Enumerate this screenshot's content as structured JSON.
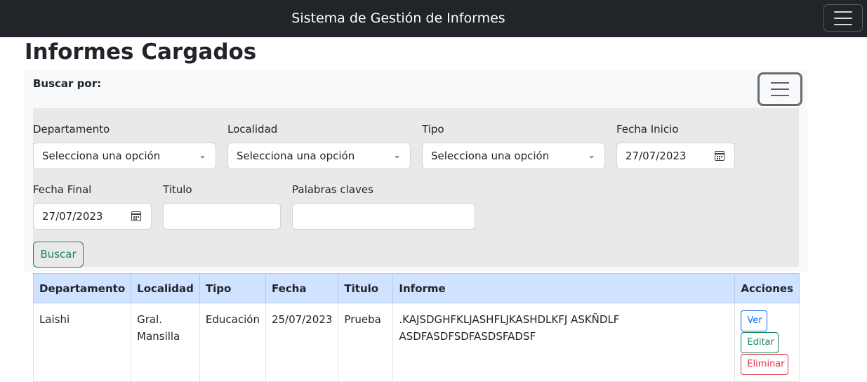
{
  "navbar": {
    "brand": "Sistema de Gestión de Informes"
  },
  "page": {
    "title": "Informes Cargados"
  },
  "search": {
    "label": "Buscar por:",
    "departamento": {
      "label": "Departamento",
      "value": "Selecciona una opción"
    },
    "localidad": {
      "label": "Localidad",
      "value": "Selecciona una opción"
    },
    "tipo": {
      "label": "Tipo",
      "value": "Selecciona una opción"
    },
    "fecha_inicio": {
      "label": "Fecha Inicio",
      "value": "27/07/2023"
    },
    "fecha_final": {
      "label": "Fecha Final",
      "value": "27/07/2023"
    },
    "titulo": {
      "label": "Titulo",
      "value": ""
    },
    "palabras": {
      "label": "Palabras claves",
      "value": ""
    },
    "button": "Buscar"
  },
  "table": {
    "headers": [
      "Departamento",
      "Localidad",
      "Tipo",
      "Fecha",
      "Titulo",
      "Informe",
      "Acciones"
    ],
    "rows": [
      {
        "departamento": "Laishi",
        "localidad": "Gral. Mansilla",
        "tipo": "Educación",
        "fecha": "25/07/2023",
        "titulo": "Prueba",
        "informe": ".KAJSDGHFKLJASHFLJKASHDLKFJ ASKÑDLF ASDFASDFSDFASDSFADSF",
        "actions": {
          "ver": "Ver",
          "editar": "Editar",
          "eliminar": "Eliminar"
        }
      }
    ]
  },
  "colors": {
    "navbar": "#212529",
    "table_header": "#cfe2ff",
    "primary": "#0d6efd",
    "success": "#198754",
    "danger": "#dc3545"
  },
  "icons": [
    "hamburger-menu-icon",
    "filter-menu-icon",
    "chevron-down-icon",
    "calendar-icon"
  ]
}
